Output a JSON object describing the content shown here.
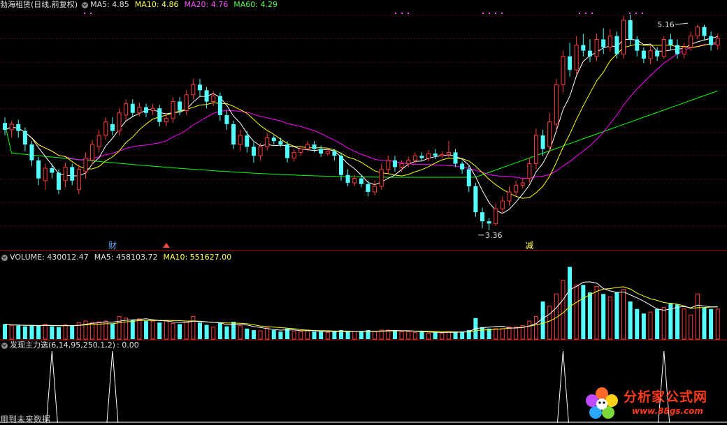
{
  "header": {
    "stock": "勃海租赁(日线,前复权)",
    "ma5": "MA5: 4.85",
    "ma10": "MA10: 4.86",
    "ma20": "MA20: 4.76",
    "ma60": "MA60: 4.29"
  },
  "vol_header": {
    "volume": "VOLUME: 430012.47",
    "ma5": "MA5: 458103.72",
    "ma10": "MA10: 551627.00"
  },
  "ind_header": {
    "name": "发现主力选(6,14,95,250,1,2)",
    "value": ": 0.00"
  },
  "footer_text": "用到未来数据",
  "watermark": {
    "title": "分析家公式网",
    "url": "www.88gs.com"
  },
  "colors": {
    "up": "#ff3c3c",
    "down": "#54ffff",
    "ma5": "#ffffff",
    "ma10": "#ffff00",
    "ma20": "#ff00ff",
    "ma60": "#00ff00",
    "grid": "#8b0000",
    "divider": "#b01818",
    "label_ma5": "#e0e0e0",
    "label_ma10": "#ffff55",
    "label_ma20": "#ff55ff",
    "label_ma60": "#55ff55"
  },
  "chart_data": {
    "type": "candlestick",
    "price_range": [
      3.2,
      5.3
    ],
    "annotations": [
      {
        "text": "5.16",
        "index": 102
      },
      {
        "text": "3.36",
        "index": 71
      },
      {
        "text": "财",
        "index": 16
      },
      {
        "text": "减",
        "index": 78
      }
    ],
    "candles": [
      [
        4.31,
        4.25,
        4.36,
        4.2,
        1
      ],
      [
        4.25,
        4.3,
        4.33,
        4.18,
        2
      ],
      [
        4.3,
        4.24,
        4.34,
        4.18,
        2
      ],
      [
        4.24,
        4.12,
        4.27,
        4.06,
        1
      ],
      [
        4.12,
        3.98,
        4.15,
        3.93,
        1
      ],
      [
        3.98,
        3.82,
        4.01,
        3.76,
        3
      ],
      [
        3.8,
        3.91,
        3.95,
        3.72,
        2
      ],
      [
        3.91,
        3.87,
        3.95,
        3.82,
        1
      ],
      [
        3.87,
        3.72,
        3.9,
        3.68,
        1
      ],
      [
        3.8,
        3.92,
        3.96,
        3.74,
        3
      ],
      [
        3.92,
        3.8,
        3.95,
        3.76,
        1
      ],
      [
        3.72,
        3.9,
        3.94,
        3.68,
        2
      ],
      [
        3.88,
        4.0,
        4.05,
        3.82,
        2
      ],
      [
        3.98,
        4.12,
        4.16,
        3.94,
        2
      ],
      [
        4.1,
        4.2,
        4.25,
        4.05,
        2
      ],
      [
        4.2,
        4.32,
        4.36,
        4.16,
        2
      ],
      [
        4.3,
        4.24,
        4.36,
        4.2,
        1
      ],
      [
        4.24,
        4.4,
        4.44,
        4.2,
        3
      ],
      [
        4.38,
        4.48,
        4.52,
        4.33,
        2
      ],
      [
        4.48,
        4.4,
        4.52,
        4.36,
        1
      ],
      [
        4.4,
        4.45,
        4.49,
        4.37,
        2
      ],
      [
        4.45,
        4.4,
        4.48,
        4.36,
        1
      ],
      [
        4.42,
        4.44,
        4.48,
        4.38,
        1
      ],
      [
        4.44,
        4.32,
        4.47,
        4.28,
        1
      ],
      [
        4.32,
        4.35,
        4.38,
        4.28,
        1
      ],
      [
        4.35,
        4.5,
        4.54,
        4.31,
        2
      ],
      [
        4.5,
        4.42,
        4.54,
        4.38,
        1
      ],
      [
        4.42,
        4.56,
        4.6,
        4.38,
        3
      ],
      [
        4.56,
        4.65,
        4.7,
        4.52,
        2
      ],
      [
        4.65,
        4.6,
        4.7,
        4.55,
        1
      ],
      [
        4.6,
        4.5,
        4.63,
        4.44,
        1
      ],
      [
        4.5,
        4.55,
        4.59,
        4.46,
        1
      ],
      [
        4.55,
        4.38,
        4.58,
        4.33,
        2
      ],
      [
        4.38,
        4.3,
        4.42,
        4.25,
        1
      ],
      [
        4.3,
        4.12,
        4.33,
        4.08,
        2
      ],
      [
        4.12,
        4.2,
        4.25,
        4.06,
        2
      ],
      [
        4.2,
        4.1,
        4.24,
        4.05,
        1
      ],
      [
        4.1,
        4.02,
        4.14,
        3.96,
        1
      ],
      [
        4.02,
        4.1,
        4.13,
        3.98,
        1
      ],
      [
        4.1,
        4.18,
        4.22,
        4.07,
        1
      ],
      [
        4.18,
        4.15,
        4.2,
        4.12,
        1
      ],
      [
        4.15,
        4.12,
        4.18,
        4.1,
        1
      ],
      [
        4.12,
        4.0,
        4.15,
        3.96,
        2
      ],
      [
        4.0,
        4.05,
        4.08,
        3.97,
        1
      ],
      [
        4.05,
        4.08,
        4.11,
        4.02,
        1
      ],
      [
        4.08,
        4.12,
        4.15,
        4.06,
        1
      ],
      [
        4.12,
        4.08,
        4.15,
        4.05,
        1
      ],
      [
        4.08,
        4.04,
        4.11,
        4.01,
        1
      ],
      [
        4.04,
        4.06,
        4.08,
        4.02,
        1
      ],
      [
        4.06,
        4.02,
        4.08,
        3.98,
        1
      ],
      [
        4.02,
        3.85,
        4.05,
        3.8,
        2
      ],
      [
        3.85,
        3.78,
        3.9,
        3.75,
        2
      ],
      [
        3.78,
        3.82,
        3.85,
        3.75,
        1
      ],
      [
        3.82,
        3.77,
        3.85,
        3.74,
        1
      ],
      [
        3.77,
        3.7,
        3.8,
        3.66,
        2
      ],
      [
        3.7,
        3.75,
        3.8,
        3.67,
        2
      ],
      [
        3.75,
        3.9,
        3.95,
        3.72,
        3
      ],
      [
        3.9,
        3.98,
        4.02,
        3.86,
        2
      ],
      [
        3.98,
        3.92,
        4.02,
        3.88,
        1
      ],
      [
        3.92,
        3.95,
        3.98,
        3.88,
        1
      ],
      [
        3.95,
        3.98,
        4.01,
        3.92,
        1
      ],
      [
        3.98,
        4.02,
        4.05,
        3.95,
        1
      ],
      [
        4.02,
        4.0,
        4.05,
        3.97,
        1
      ],
      [
        4.0,
        4.04,
        4.07,
        3.97,
        1
      ],
      [
        4.04,
        4.02,
        4.08,
        3.99,
        1
      ],
      [
        4.02,
        4.03,
        4.06,
        4.0,
        1
      ],
      [
        4.03,
        4.05,
        4.15,
        4.0,
        1
      ],
      [
        4.05,
        3.95,
        4.08,
        3.92,
        1
      ],
      [
        3.95,
        3.9,
        3.97,
        3.86,
        1
      ],
      [
        3.9,
        3.75,
        3.93,
        3.7,
        2
      ],
      [
        3.75,
        3.52,
        3.78,
        3.48,
        2
      ],
      [
        3.52,
        3.44,
        3.56,
        3.38,
        2
      ],
      [
        3.44,
        3.42,
        3.47,
        3.36,
        1
      ],
      [
        3.42,
        3.55,
        3.6,
        3.4,
        2
      ],
      [
        3.55,
        3.62,
        3.66,
        3.51,
        2
      ],
      [
        3.62,
        3.7,
        3.75,
        3.58,
        2
      ],
      [
        3.7,
        3.76,
        3.8,
        3.66,
        2
      ],
      [
        3.76,
        3.78,
        3.82,
        3.73,
        1
      ],
      [
        3.82,
        3.95,
        4.0,
        3.78,
        2
      ],
      [
        3.95,
        4.2,
        4.26,
        3.9,
        3
      ],
      [
        4.2,
        4.08,
        4.25,
        4.02,
        2
      ],
      [
        4.1,
        4.32,
        4.4,
        4.05,
        3
      ],
      [
        4.3,
        4.65,
        4.7,
        4.25,
        3
      ],
      [
        4.65,
        4.9,
        4.95,
        4.58,
        3
      ],
      [
        4.9,
        4.78,
        5.02,
        4.72,
        3
      ],
      [
        4.78,
        5.0,
        5.08,
        4.74,
        3
      ],
      [
        5.0,
        4.95,
        5.1,
        4.9,
        2
      ],
      [
        4.95,
        4.9,
        5.05,
        4.85,
        2
      ],
      [
        4.9,
        5.05,
        5.1,
        4.86,
        2
      ],
      [
        5.05,
        4.98,
        5.15,
        4.92,
        2
      ],
      [
        4.98,
        5.08,
        5.14,
        4.94,
        2
      ],
      [
        5.08,
        4.92,
        5.12,
        4.88,
        2
      ],
      [
        4.92,
        5.22,
        5.26,
        4.88,
        3
      ],
      [
        5.22,
        5.05,
        5.27,
        5.0,
        2
      ],
      [
        5.05,
        4.95,
        5.08,
        4.9,
        2
      ],
      [
        4.95,
        4.88,
        4.98,
        4.84,
        1
      ],
      [
        4.88,
        4.95,
        4.99,
        4.83,
        1
      ],
      [
        4.95,
        4.9,
        4.98,
        4.86,
        1
      ],
      [
        4.9,
        5.05,
        5.08,
        4.88,
        2
      ],
      [
        5.05,
        5.0,
        5.1,
        4.96,
        2
      ],
      [
        5.0,
        4.92,
        5.05,
        4.88,
        1
      ],
      [
        4.92,
        4.98,
        5.02,
        4.88,
        1
      ],
      [
        4.98,
        5.08,
        5.12,
        4.95,
        2
      ],
      [
        5.08,
        5.16,
        5.18,
        5.05,
        3
      ],
      [
        5.16,
        5.08,
        5.18,
        5.04,
        2
      ],
      [
        5.08,
        5.0,
        5.12,
        4.95,
        2
      ],
      [
        5.0,
        5.06,
        5.1,
        4.96,
        2
      ]
    ],
    "volumes": [
      0.2,
      0.18,
      0.18,
      0.17,
      0.18,
      0.18,
      0.2,
      0.17,
      0.16,
      0.19,
      0.18,
      0.22,
      0.24,
      0.22,
      0.23,
      0.24,
      0.2,
      0.3,
      0.28,
      0.26,
      0.27,
      0.24,
      0.24,
      0.22,
      0.24,
      0.21,
      0.2,
      0.24,
      0.3,
      0.22,
      0.19,
      0.16,
      0.22,
      0.17,
      0.23,
      0.18,
      0.14,
      0.12,
      0.11,
      0.15,
      0.12,
      0.1,
      0.14,
      0.1,
      0.1,
      0.12,
      0.1,
      0.1,
      0.09,
      0.1,
      0.12,
      0.1,
      0.1,
      0.1,
      0.12,
      0.1,
      0.12,
      0.12,
      0.12,
      0.1,
      0.1,
      0.09,
      0.1,
      0.08,
      0.09,
      0.08,
      0.1,
      0.1,
      0.1,
      0.12,
      0.28,
      0.16,
      0.14,
      0.14,
      0.14,
      0.16,
      0.16,
      0.18,
      0.24,
      0.3,
      0.5,
      0.44,
      0.6,
      0.78,
      0.96,
      0.72,
      0.72,
      0.62,
      0.7,
      0.6,
      0.56,
      0.62,
      0.66,
      0.5,
      0.4,
      0.34,
      0.36,
      0.4,
      0.42,
      0.48,
      0.46,
      0.4,
      0.32,
      0.6,
      0.42,
      0.4,
      0.4
    ],
    "volume_range": [
      0,
      1.0
    ],
    "indicator_spikes": [
      7,
      16,
      83,
      98
    ],
    "indicator_range": [
      0,
      1
    ]
  }
}
